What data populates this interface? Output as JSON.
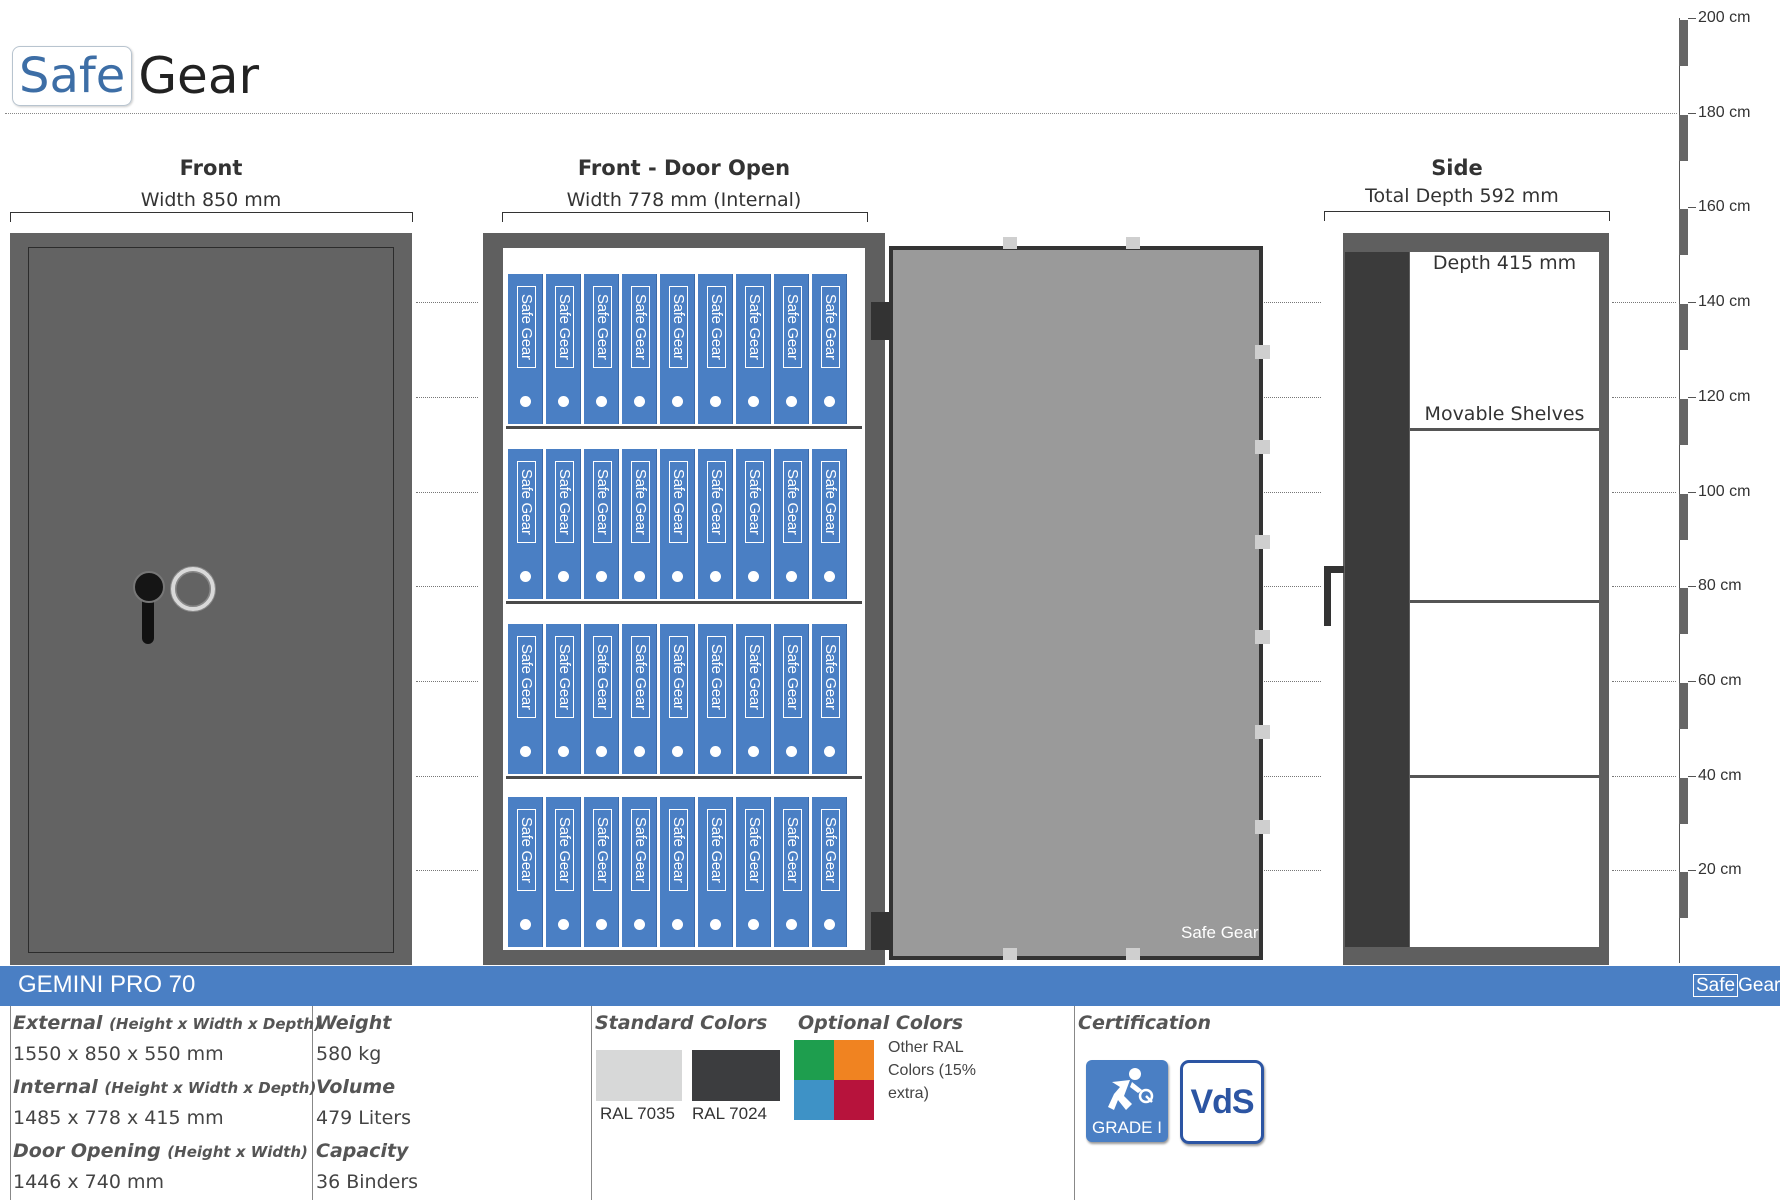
{
  "brand": {
    "logo_safe": "Safe",
    "logo_gear": "Gear",
    "door_logo": "Safe Gear"
  },
  "views": {
    "front": {
      "title": "Front",
      "subtitle": "Width 850 mm"
    },
    "open": {
      "title": "Front - Door Open",
      "subtitle": "Width 778 mm (Internal)"
    },
    "side": {
      "title": "Side",
      "subtitle": "Total Depth 592 mm",
      "depth_label": "Depth 415 mm",
      "shelves_label": "Movable Shelves"
    }
  },
  "binder_label": "Safe Gear",
  "binders_per_shelf": 9,
  "shelf_count": 4,
  "ruler": {
    "labels": [
      "200 cm",
      "180 cm",
      "160 cm",
      "140 cm",
      "120 cm",
      "100 cm",
      "80 cm",
      "60 cm",
      "40 cm",
      "20 cm"
    ]
  },
  "product": {
    "name": "GEMINI PRO 70",
    "banner_logo_safe": "Safe",
    "banner_logo_gear": "Gear"
  },
  "specs": {
    "external_label": "External",
    "external_note": "(Height x Width x Depth)",
    "external_value": "1550 x 850 x 550 mm",
    "internal_label": "Internal",
    "internal_note": "(Height x Width x Depth)",
    "internal_value": "1485 x 778 x 415 mm",
    "door_label": "Door Opening",
    "door_note": "(Height x Width)",
    "door_value": "1446 x 740 mm",
    "weight_label": "Weight",
    "weight_value": "580 kg",
    "volume_label": "Volume",
    "volume_value": "479 Liters",
    "capacity_label": "Capacity",
    "capacity_value": "36 Binders"
  },
  "colors": {
    "standard_label": "Standard Colors",
    "standard": [
      {
        "name": "RAL 7035",
        "hex": "#d7d8d8"
      },
      {
        "name": "RAL 7024",
        "hex": "#3c3d3f"
      }
    ],
    "optional_label": "Optional Colors",
    "optional_hex": [
      "#1e9e4e",
      "#f08321",
      "#3e92c6",
      "#b7133c"
    ],
    "optional_note": "Other RAL Colors (15% extra)"
  },
  "certification": {
    "label": "Certification",
    "grade": "GRADE I",
    "vds": "VdS"
  },
  "accent": "#4a7fc4"
}
